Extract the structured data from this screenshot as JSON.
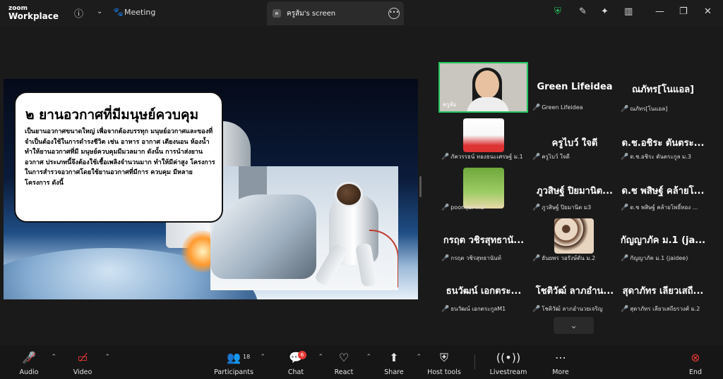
{
  "titlebar": {
    "logo_line1": "zoom",
    "logo_line2": "Workplace",
    "meeting_label": "Meeting",
    "screen_tab_avatar": "ค",
    "screen_tab_label": "ครูส้ม's screen",
    "icons": [
      "info-icon",
      "chevron-down-icon",
      "paw-icon",
      "more-icon",
      "shield-icon",
      "pen-icon",
      "sparkle-icon",
      "layout-icon",
      "minimize-icon",
      "restore-icon",
      "close-icon"
    ]
  },
  "share": {
    "heading": "๒ ยานอวกาศที่มีมนุษย์ควบคุม",
    "body": "เป็นยานอวกาศขนาดใหญ่ เพื่อจากต้องบรรทุก มนุษย์อวกาศและของที่จำเป็นต้องใช้ในการดำรงชีวิต เช่น อาหาร อากาศ เตียงนอน ห้องน้ำ ทำให้ยานอวกาศที่มี มนุษย์ควบคุมมีมวลมาก ดังนั้น การนำส่งยานอวกาศ ประเภทนี้จึงต้องใช้เชื้อเพลิงจำนวนมาก ทำให้มีค่าสูง โครงการในการสำรวจอวกาศโดยใช้ยานอวกาศที่มีการ ควบคุม มีหลายโครงการ ดังนี้"
  },
  "participants_grid": [
    {
      "name": "",
      "label": "ครูส้ม",
      "type": "camera"
    },
    {
      "name": "Green Lifeidea",
      "label": "Green Lifeidea"
    },
    {
      "name": "ณภัทร[โนแอล]",
      "label": "ณภัทร[โนแอล]"
    },
    {
      "name": "",
      "label": "ภัควรรธน์ ทองธนะเศรษฐ์ ม.1",
      "type": "avatar-cartoon"
    },
    {
      "name": "ครูไบว์ ใจดี",
      "label": "ครูไบว์ ใจดี"
    },
    {
      "name": "ด.ช.อชิระ ตันตระ...",
      "label": "ด.ช.อชิระ ตันตระกูล ม.3"
    },
    {
      "name": "",
      "label": "poomjai-m3",
      "type": "avatar-golf"
    },
    {
      "name": "ภูวสิษฐ์ ปิยมานิต...",
      "label": "ภูวสิษฐ์ ปิยมานิต ม3"
    },
    {
      "name": "ด.ช พสิษฐ์ คล้ายโ...",
      "label": "ด.ช พสิษฐ์ คล้ายโพธิ์ทอง ..."
    },
    {
      "name": "กรฤต วชิรสุทธานั...",
      "label": "กรฤต วชิรสุทธานันท์"
    },
    {
      "name": "",
      "label": "ธันยพร วอรังษ์ตัน ม.2",
      "type": "avatar-cookie"
    },
    {
      "name": "กัญญาภัค ม.1 (ja...",
      "label": "กัญญาภัค ม.1 (jaidee)"
    },
    {
      "name": "ธนวัฒน์ เอกตระ...",
      "label": "ธนวัฒน์ เอกตระกูลM1"
    },
    {
      "name": "โชติวัฒ์ ลาภอำน...",
      "label": "โชติวัฒ์ ลาภอำนวยเจริญ"
    },
    {
      "name": "สุดาภัทร เลียวเสถี...",
      "label": "สุดาภัทร เลียวเสถียรวงศ์ ม.2"
    }
  ],
  "toolbar": {
    "audio": "Audio",
    "video": "Video",
    "participants": "Participants",
    "participants_count": "18",
    "chat": "Chat",
    "chat_badge": "6",
    "react": "React",
    "share": "Share",
    "host_tools": "Host tools",
    "livestream": "Livestream",
    "more": "More",
    "end": "End"
  },
  "colors": {
    "accent_green": "#22c55e",
    "muted_red": "#e53935"
  }
}
